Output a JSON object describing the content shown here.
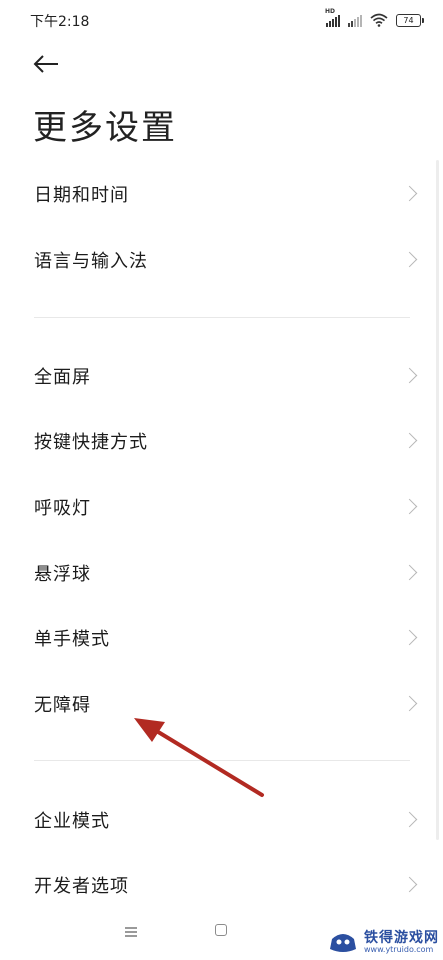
{
  "status_bar": {
    "time": "下午2:18",
    "hd_label": "HD",
    "battery": "74"
  },
  "page": {
    "title": "更多设置"
  },
  "items_group1": [
    {
      "label": "日期和时间"
    },
    {
      "label": "语言与输入法"
    }
  ],
  "items_group2": [
    {
      "label": "全面屏"
    },
    {
      "label": "按键快捷方式"
    },
    {
      "label": "呼吸灯"
    },
    {
      "label": "悬浮球"
    },
    {
      "label": "单手模式"
    },
    {
      "label": "无障碍"
    }
  ],
  "items_group3": [
    {
      "label": "企业模式"
    },
    {
      "label": "开发者选项"
    }
  ],
  "watermark": {
    "title": "铁得游戏网",
    "url": "www.ytruido.com"
  },
  "colors": {
    "annotation_arrow": "#b22a22",
    "watermark_blue": "#2b4fa0"
  },
  "icons": [
    "back-arrow-icon",
    "chevron-right-icon",
    "signal-icon",
    "wifi-icon",
    "battery-icon",
    "menu-icon",
    "home-icon"
  ]
}
